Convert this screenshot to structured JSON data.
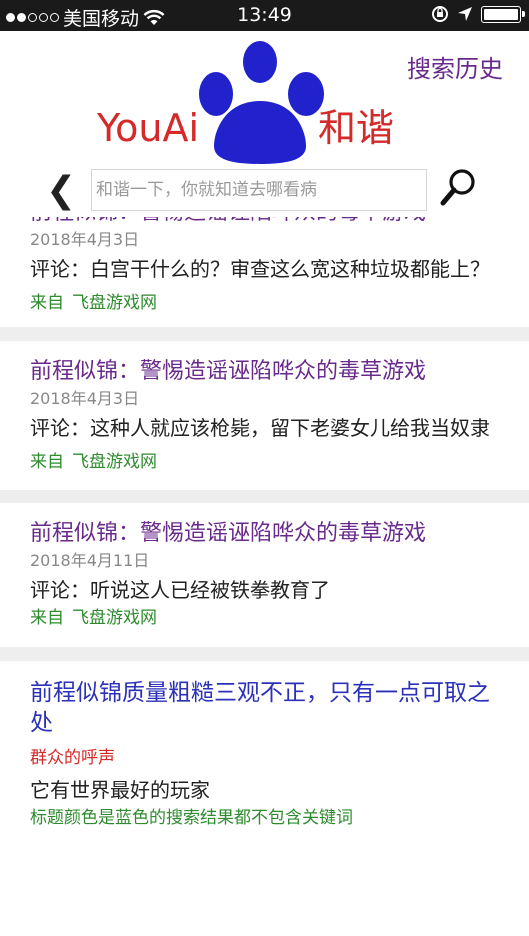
{
  "status_bar": {
    "carrier": "美国移动",
    "time": "13:49"
  },
  "header": {
    "logo_text_left": "YouAi",
    "logo_text_right": "和谐",
    "history_link": "搜索历史",
    "back_label": "❮",
    "search_placeholder": "和谐一下，你就知道去哪看病",
    "colors": {
      "logo_red": "#d42a2a",
      "logo_blue": "#2222cc",
      "link_purple": "#6a2a8c"
    }
  },
  "results": [
    {
      "title": "前程似锦：警惕造谣诬陷哗众的毒草游戏",
      "date": "2018年4月3日",
      "comment": "评论：白宫干什么的？审查这么宽这种垃圾都能上？",
      "source_prefix": "来自",
      "source_name": "飞盘游戏网"
    },
    {
      "title": "前程似锦：警惕造谣诬陷哗众的毒草游戏",
      "date": "2018年4月3日",
      "comment": "评论：这种人就应该枪毙，留下老婆女儿给我当奴隶",
      "source_prefix": "来自",
      "source_name": "飞盘游戏网"
    },
    {
      "title": "前程似锦：警惕造谣诬陷哗众的毒草游戏",
      "date": "2018年4月11日",
      "comment": "评论：听说这人已经被铁拳教育了",
      "source_prefix": "来自",
      "source_name": "飞盘游戏网"
    }
  ],
  "last_result": {
    "title": "前程似锦质量粗糙三观不正，只有一点可取之处",
    "tag": "群众的呼声",
    "body": "它有世界最好的玩家",
    "note": "标题颜色是蓝色的搜索结果都不包含关键词"
  }
}
